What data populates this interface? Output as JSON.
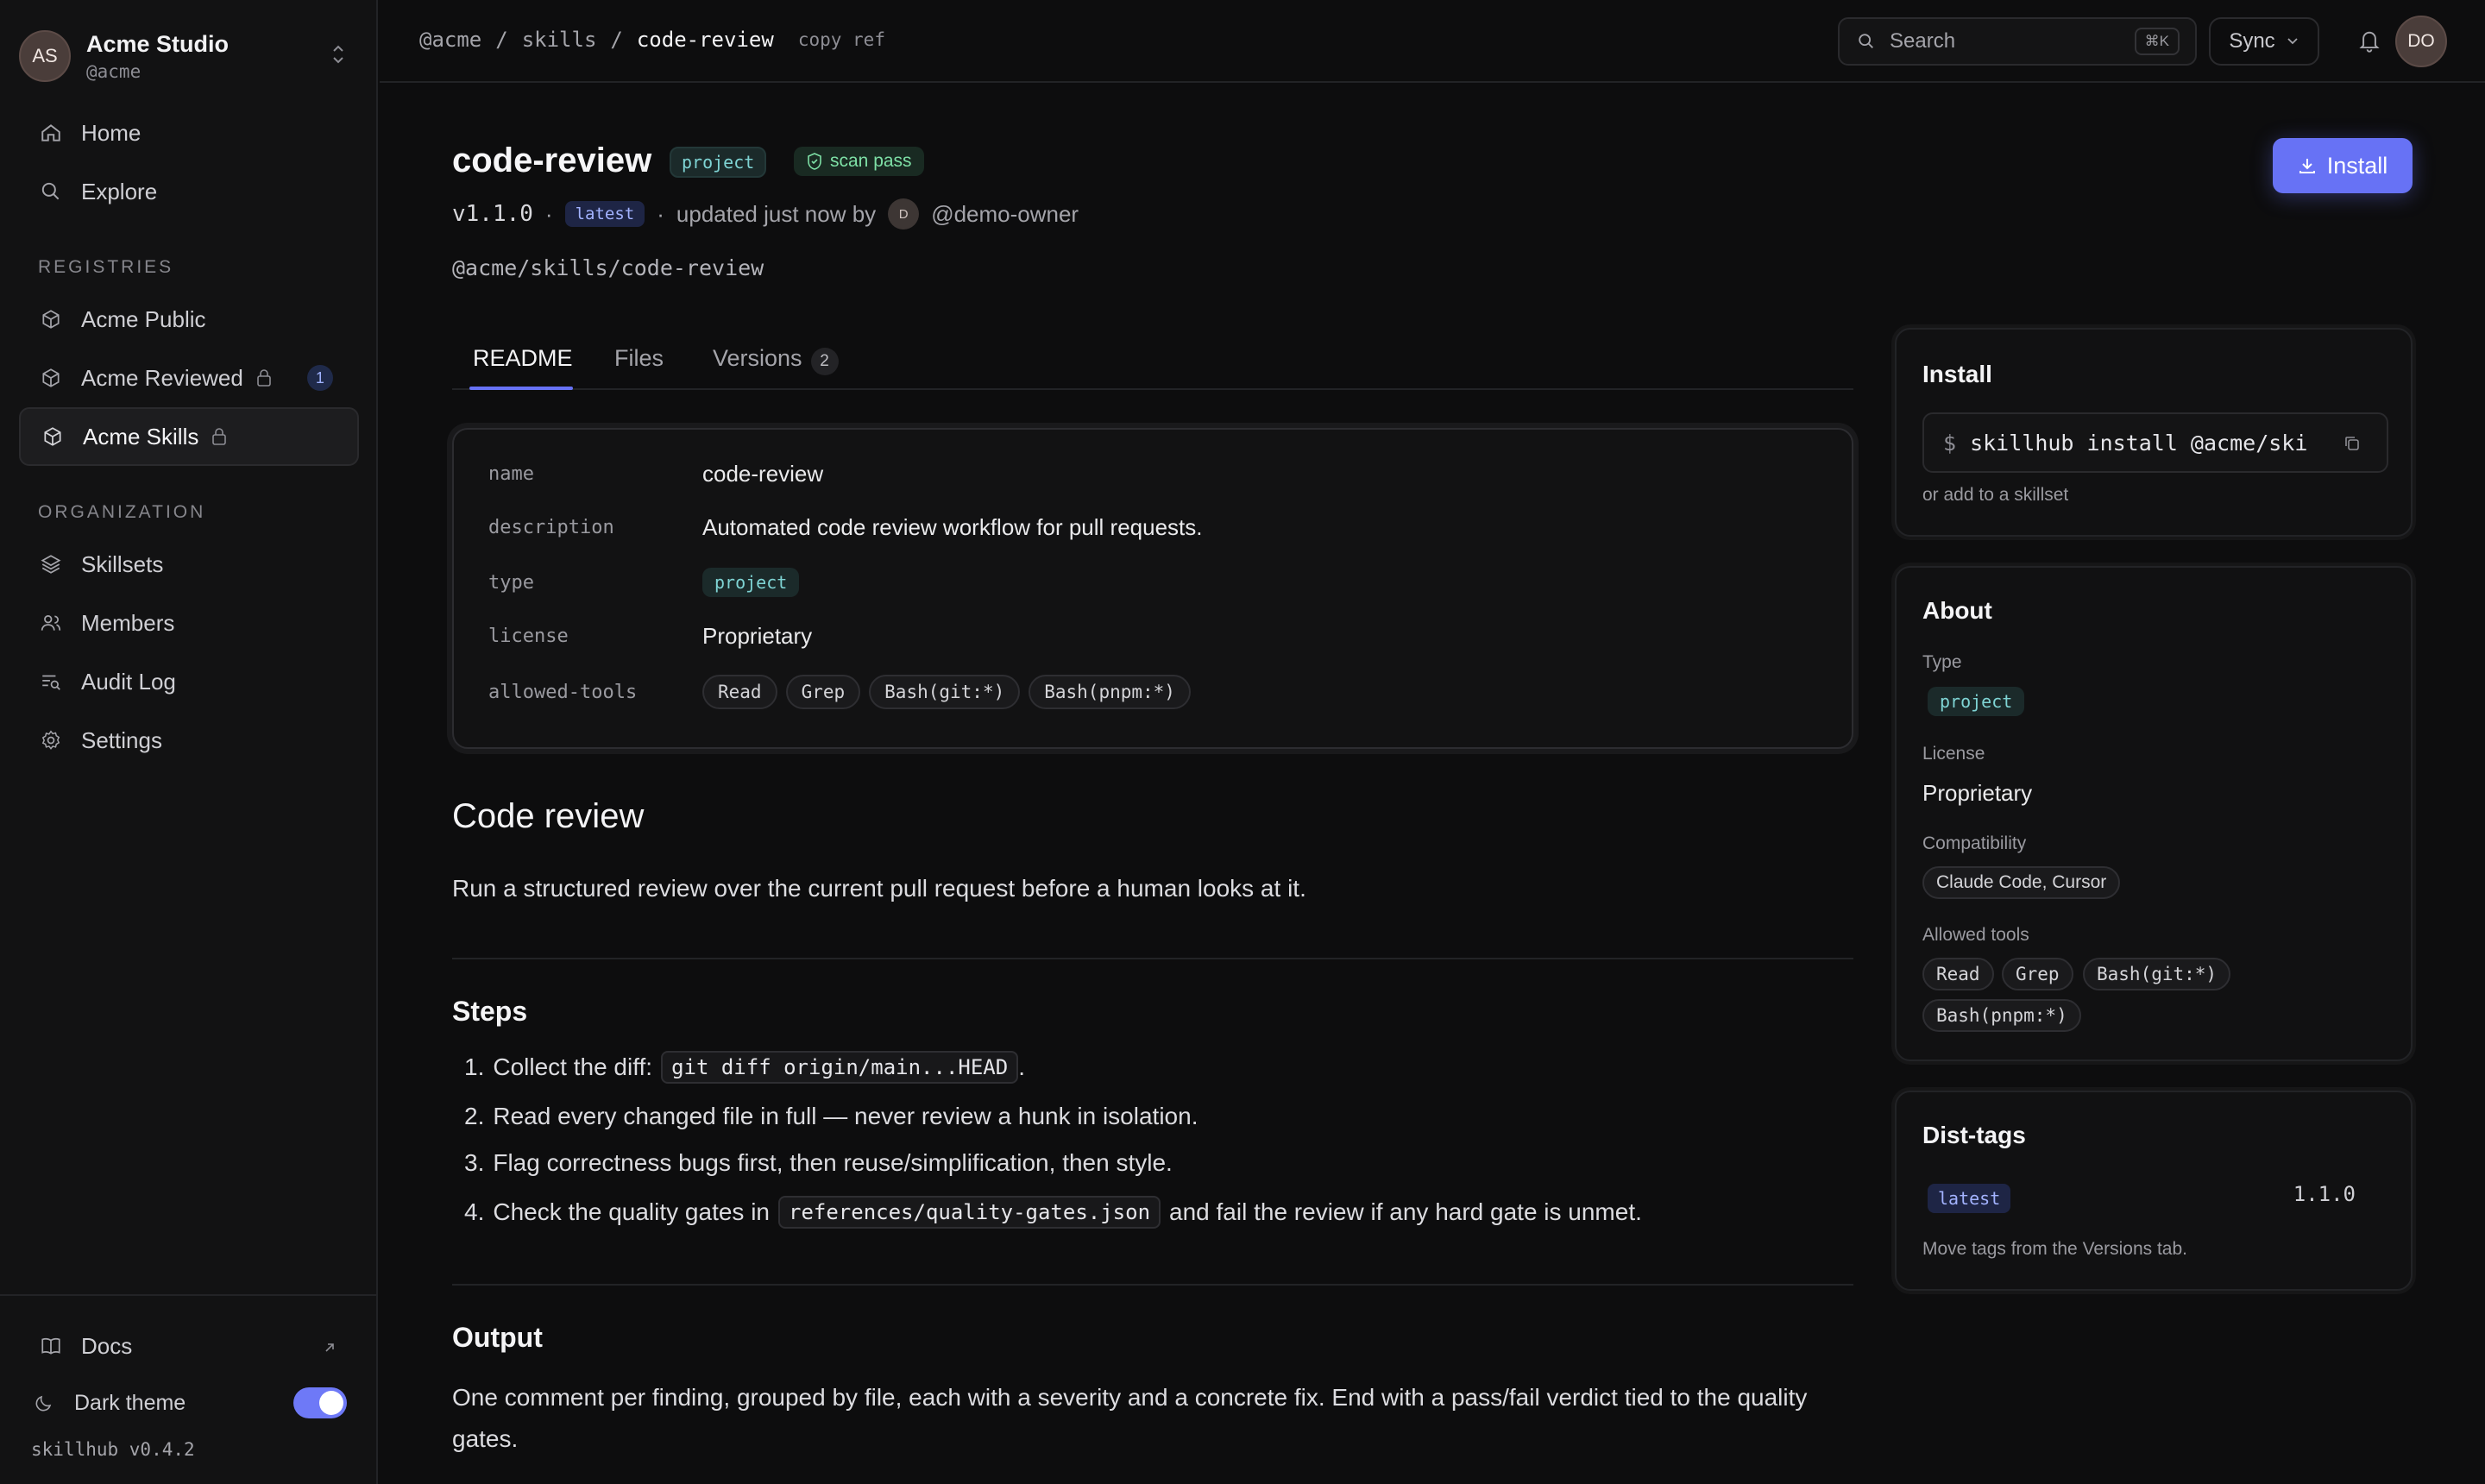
{
  "org": {
    "avatar": "AS",
    "name": "Acme Studio",
    "handle": "@acme"
  },
  "nav": {
    "home": "Home",
    "explore": "Explore",
    "registries_heading": "REGISTRIES",
    "registries": [
      {
        "label": "Acme Public"
      },
      {
        "label": "Acme Reviewed",
        "count": "1"
      },
      {
        "label": "Acme Skills"
      }
    ],
    "organization_heading": "ORGANIZATION",
    "organization": [
      {
        "label": "Skillsets"
      },
      {
        "label": "Members"
      },
      {
        "label": "Audit Log"
      },
      {
        "label": "Settings"
      }
    ],
    "docs": "Docs",
    "dark_theme": "Dark theme",
    "dark_theme_on": true,
    "version": "skillhub v0.4.2"
  },
  "topbar": {
    "breadcrumb": [
      "@acme",
      "/",
      "skills",
      "/",
      "code-review"
    ],
    "copy_ref": "copy ref",
    "search_placeholder": "Search",
    "search_shortcut": "⌘K",
    "sync": "Sync",
    "user_avatar": "DO"
  },
  "skill": {
    "name": "code-review",
    "type_pill": "project",
    "scan": "scan pass",
    "version": "v1.1.0",
    "sep": "·",
    "tag": "latest",
    "updated": "updated just now by",
    "owner_avatar": "D",
    "owner": "@demo-owner",
    "ref": "@acme/skills/code-review",
    "install_button": "Install"
  },
  "tabs": [
    {
      "label": "README"
    },
    {
      "label": "Files"
    },
    {
      "label": "Versions",
      "count": "2"
    }
  ],
  "frontmatter": {
    "name_key": "name",
    "name_val": "code-review",
    "description_key": "description",
    "description_val": "Automated code review workflow for pull requests.",
    "type_key": "type",
    "type_val": "project",
    "license_key": "license",
    "license_val": "Proprietary",
    "tools_key": "allowed-tools",
    "tools": [
      "Read",
      "Grep",
      "Bash(git:*)",
      "Bash(pnpm:*)"
    ]
  },
  "readme": {
    "h1": "Code review",
    "intro": "Run a structured review over the current pull request before a human looks at it.",
    "steps_heading": "Steps",
    "steps": [
      {
        "num": "1.",
        "before": "Collect the diff:",
        "code": "git diff origin/main...HEAD",
        "after": "."
      },
      {
        "num": "2.",
        "before": "Read every changed file in full — never review a hunk in isolation."
      },
      {
        "num": "3.",
        "before": "Flag correctness bugs first, then reuse/simplification, then style."
      },
      {
        "num": "4.",
        "before": "Check the quality gates in",
        "code": "references/quality-gates.json",
        "after": "and fail the review if any hard gate is unmet."
      }
    ],
    "output_heading": "Output",
    "output_line1": "One comment per finding, grouped by file, each with a severity and a concrete fix. End with a pass/fail verdict tied to the quality",
    "output_line2": "gates."
  },
  "install_card": {
    "title": "Install",
    "command": "skillhub install @acme/ski",
    "prompt": "$",
    "alt": "or add to a skillset"
  },
  "about": {
    "title": "About",
    "type_label": "Type",
    "type_val": "project",
    "license_label": "License",
    "license_val": "Proprietary",
    "compat_label": "Compatibility",
    "compat_val": "Claude Code, Cursor",
    "tools_label": "Allowed tools",
    "tools": [
      "Read",
      "Grep",
      "Bash(git:*)",
      "Bash(pnpm:*)"
    ]
  },
  "dist_tags": {
    "title": "Dist-tags",
    "tag": "latest",
    "version": "1.1.0",
    "hint": "Move tags from the Versions tab."
  },
  "colors": {
    "accent": "#6772f5",
    "bg": "#0d0d0e",
    "teal": "#7fd4d4",
    "green": "#7ee0a6"
  }
}
